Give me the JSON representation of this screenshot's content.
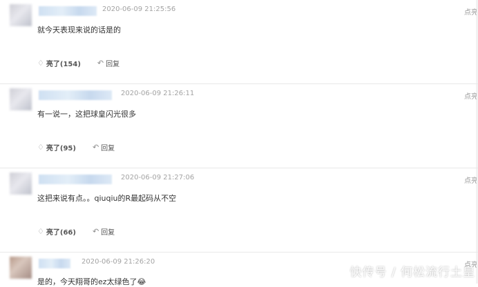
{
  "comments": [
    {
      "time": "2020-06-09 21:25:56",
      "text": "就今天表现来说的话是的",
      "like_label": "亮了(154)",
      "reply_label": "回复",
      "report_label": "点亮"
    },
    {
      "time": "2020-06-09 21:26:11",
      "text": "有一说一，这把球皇闪光很多",
      "like_label": "亮了(95)",
      "reply_label": "回复",
      "report_label": "点亮"
    },
    {
      "time": "2020-06-09 21:27:06",
      "text": "这把来说有点。。qiuqiu的R最起码从不空",
      "like_label": "亮了(66)",
      "reply_label": "回复",
      "report_label": "点亮"
    },
    {
      "time": "2020-06-09 21:26:20",
      "text": "是的，今天翔哥的ez太绿色了😂",
      "report_label": "点亮"
    }
  ],
  "icons": {
    "like": "lightbulb-icon",
    "reply": "reply-arrow-icon"
  },
  "watermark": "快传号 / 何松流行土皇"
}
